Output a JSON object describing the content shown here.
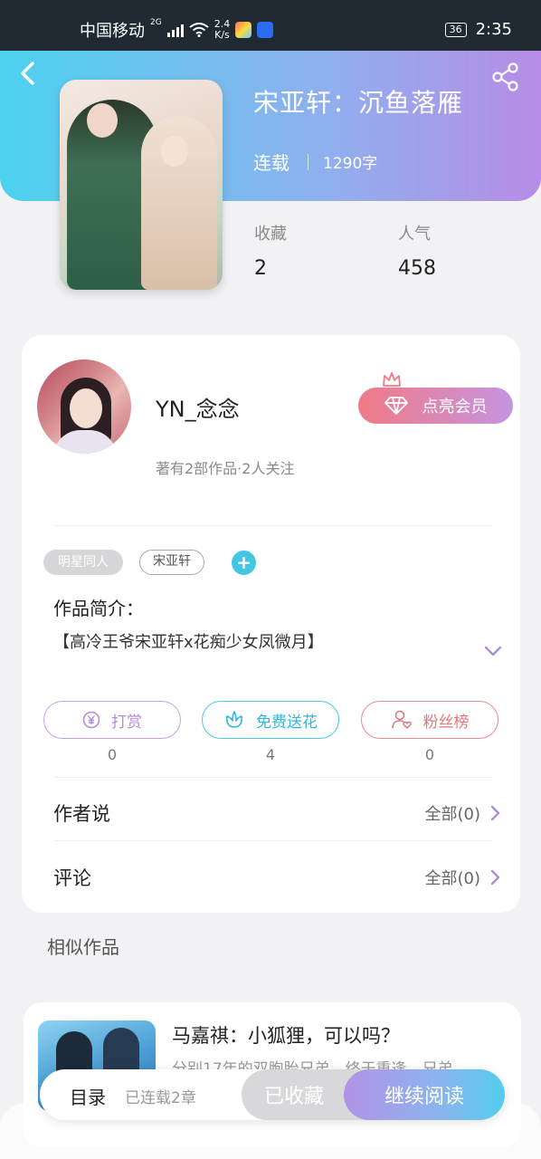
{
  "status_bar": {
    "carrier": "中国移动",
    "signal_type": "2G",
    "net_speed_value": "2.4",
    "net_speed_unit": "K/s",
    "battery": "36",
    "time": "2:35"
  },
  "header": {
    "book_title": "宋亚轩：沉鱼落雁",
    "status": "连载",
    "word_count": "1290字",
    "stats": [
      {
        "label": "收藏",
        "value": "2"
      },
      {
        "label": "人气",
        "value": "458"
      }
    ]
  },
  "author": {
    "name": "YN_念念",
    "stats_text": "著有2部作品·2人关注",
    "vip_button": "点亮会员"
  },
  "tags": [
    "明星同人",
    "宋亚轩"
  ],
  "intro": {
    "title": "作品简介：",
    "text": "【高冷王爷宋亚轩x花痴少女凤微月】"
  },
  "actions": [
    {
      "label": "打赏",
      "count": "0",
      "icon": "yen-icon"
    },
    {
      "label": "免费送花",
      "count": "4",
      "icon": "flower-icon"
    },
    {
      "label": "粉丝榜",
      "count": "0",
      "icon": "fan-user-icon"
    }
  ],
  "rows": [
    {
      "label": "作者说",
      "right": "全部(0)"
    },
    {
      "label": "评论",
      "right": "全部(0)"
    }
  ],
  "similar": {
    "section_title": "相似作品",
    "items": [
      {
        "title": "马嘉祺：小狐狸，可以吗？",
        "desc": "分别17年的双胞胎兄弟，终于重逢。兄弟"
      }
    ]
  },
  "bottom_bar": {
    "toc_label": "目录",
    "toc_sub": "已连载2章",
    "collected_label": "已收藏",
    "read_label": "继续阅读"
  },
  "colors": {
    "header_gradient_start": "#4cd2ee",
    "header_gradient_end": "#b78ce6",
    "accent_cyan": "#43c6e4",
    "vip_pink": "#f07a86",
    "chevron_purple": "#b48cd6"
  }
}
